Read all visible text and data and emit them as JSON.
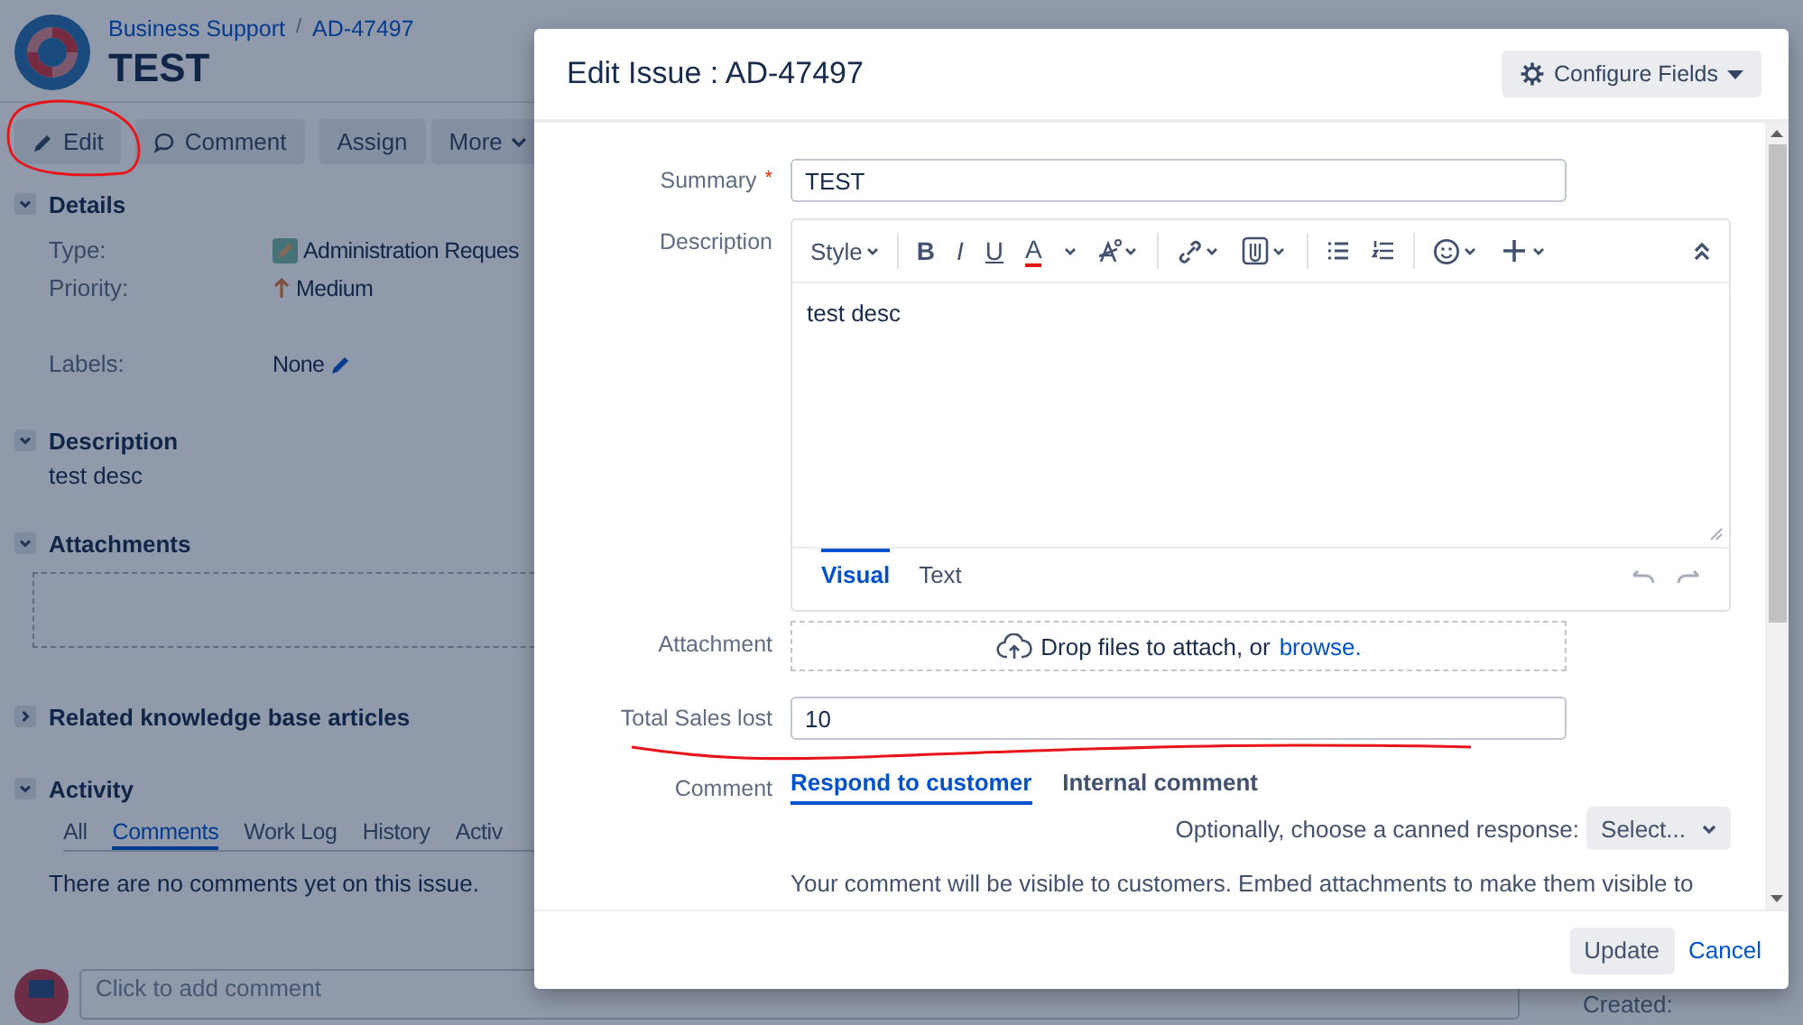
{
  "page": {
    "breadcrumb": {
      "project": "Business Support",
      "separator": "/",
      "issue_key": "AD-47497"
    },
    "title": "TEST",
    "toolbar": [
      {
        "kind": "edit",
        "label": "Edit"
      },
      {
        "kind": "comment",
        "label": "Comment"
      },
      {
        "kind": "plain",
        "label": "Assign"
      },
      {
        "kind": "dropdown",
        "label": "More"
      }
    ],
    "details": {
      "heading": "Details",
      "expanded": true,
      "fields": [
        {
          "kind": "type",
          "label": "Type:",
          "value": "Administration Reques"
        },
        {
          "kind": "priority",
          "label": "Priority:",
          "value": "Medium"
        },
        {
          "kind": "labels",
          "label": "Labels:",
          "value": "None"
        }
      ]
    },
    "description": {
      "heading": "Description",
      "expanded": true,
      "text": "test desc"
    },
    "attachments": {
      "heading": "Attachments",
      "expanded": true
    },
    "related": {
      "heading": "Related knowledge base articles",
      "expanded": false
    },
    "activity": {
      "heading": "Activity",
      "expanded": true,
      "tabs": [
        {
          "label": "All",
          "selected": false
        },
        {
          "label": "Comments",
          "selected": true
        },
        {
          "label": "Work Log",
          "selected": false
        },
        {
          "label": "History",
          "selected": false
        },
        {
          "label": "Activ",
          "selected": false
        }
      ],
      "empty_text": "There are no comments yet on this issue."
    },
    "comment_box": {
      "placeholder": "Click to add comment"
    },
    "side_panel": {
      "created_label": "Created:"
    }
  },
  "dialog": {
    "title": "Edit Issue : AD-47497",
    "configure_button": "Configure Fields",
    "required_mark": "*",
    "fields": [
      {
        "kind": "text",
        "label": "Summary",
        "required": true,
        "value": "TEST"
      },
      {
        "kind": "editor",
        "label": "Description",
        "required": false,
        "value": "test desc",
        "toolbar": [
          [
            {
              "kind": "style",
              "label": "Style"
            }
          ],
          [
            {
              "kind": "bold",
              "label": "B"
            },
            {
              "kind": "italic",
              "label": "I"
            },
            {
              "kind": "underline",
              "label": "U"
            },
            {
              "kind": "color",
              "label": "A"
            },
            {
              "kind": "clear"
            }
          ],
          [
            {
              "kind": "link"
            },
            {
              "kind": "attach"
            }
          ],
          [
            {
              "kind": "bullets"
            },
            {
              "kind": "numbers"
            }
          ],
          [
            {
              "kind": "emoji"
            },
            {
              "kind": "plus"
            }
          ]
        ],
        "modes": [
          {
            "label": "Visual",
            "selected": true
          },
          {
            "label": "Text",
            "selected": false
          }
        ]
      },
      {
        "kind": "attachment",
        "label": "Attachment",
        "required": false,
        "text": "Drop files to attach, or",
        "link": "browse."
      },
      {
        "kind": "text",
        "label": "Total Sales lost",
        "required": false,
        "value": "10"
      },
      {
        "kind": "comment",
        "label": "Comment",
        "required": false,
        "tabs": [
          {
            "label": "Respond to customer",
            "selected": true
          },
          {
            "label": "Internal comment",
            "selected": false
          }
        ],
        "canned_label": "Optionally, choose a canned response:",
        "canned_button": "Select...",
        "note": "Your comment will be visible to customers. Embed attachments to make them visible to"
      }
    ],
    "footer": {
      "submit": "Update",
      "cancel": "Cancel"
    }
  }
}
